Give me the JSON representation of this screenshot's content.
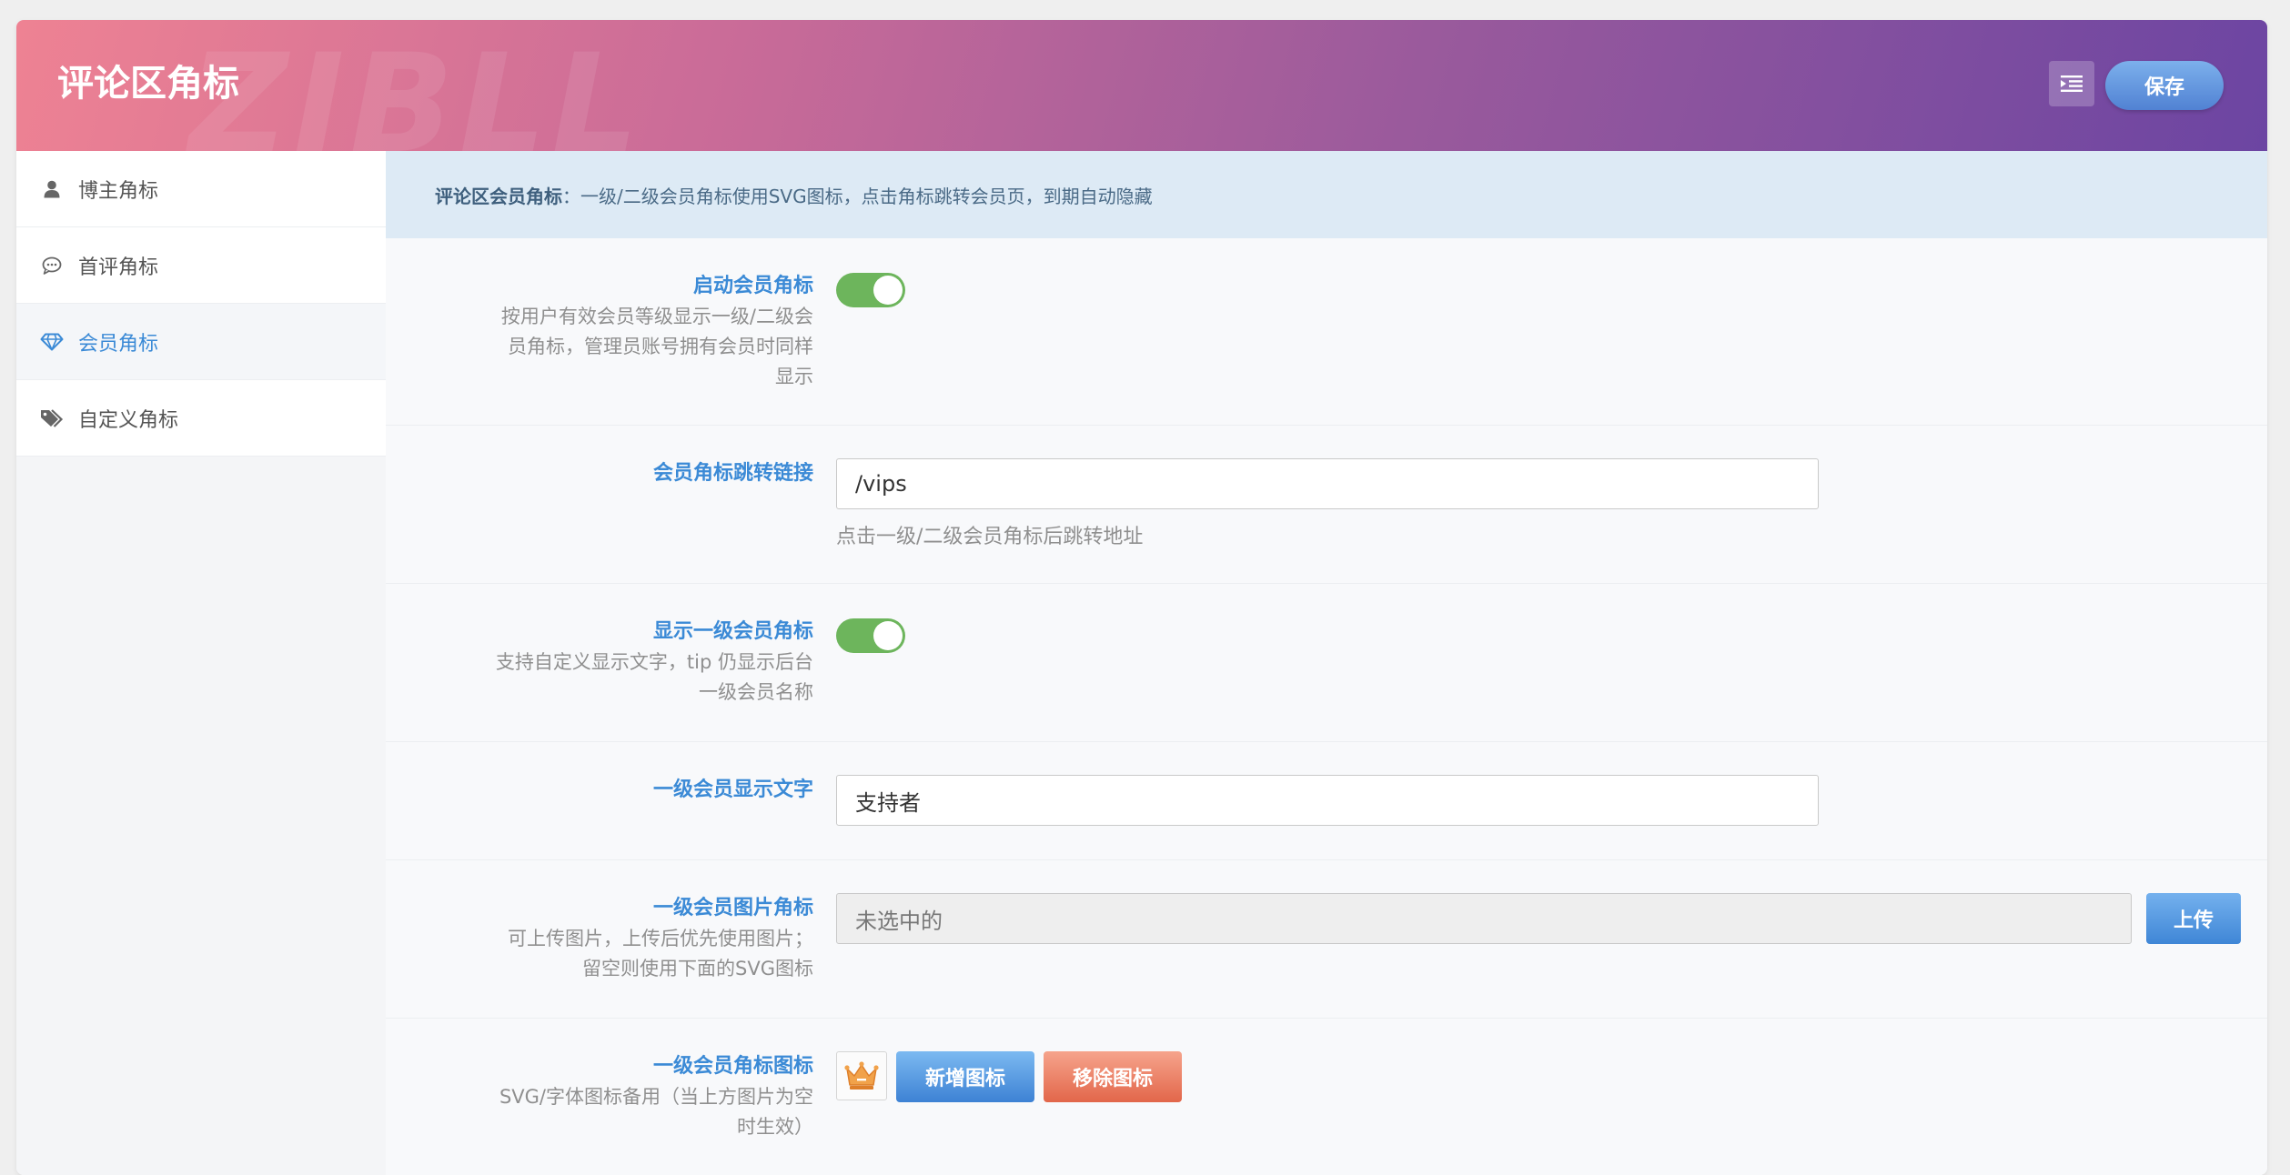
{
  "header": {
    "title": "评论区角标",
    "watermark": "ZIBLL",
    "save_label": "保存"
  },
  "sidebar": {
    "items": [
      {
        "label": "博主角标",
        "icon": "user-icon"
      },
      {
        "label": "首评角标",
        "icon": "comment-icon"
      },
      {
        "label": "会员角标",
        "icon": "diamond-icon",
        "active": true
      },
      {
        "label": "自定义角标",
        "icon": "tags-icon"
      }
    ]
  },
  "notice": {
    "title": "评论区会员角标",
    "sep": "：",
    "text": "一级/二级会员角标使用SVG图标，点击角标跳转会员页，到期自动隐藏"
  },
  "fields": {
    "enable": {
      "label": "启动会员角标",
      "desc_lines": [
        "按用户有效会员等级显示一级/二级会",
        "员角标，管理员账号拥有会员时同样",
        "显示"
      ],
      "on": true
    },
    "link": {
      "label": "会员角标跳转链接",
      "value": "/vips",
      "help": "点击一级/二级会员角标后跳转地址"
    },
    "show_level1": {
      "label": "显示一级会员角标",
      "desc_lines": [
        "支持自定义显示文字，tip 仍显示后台",
        "一级会员名称"
      ],
      "on": true
    },
    "level1_text": {
      "label": "一级会员显示文字",
      "value": "支持者"
    },
    "level1_image": {
      "label": "一级会员图片角标",
      "desc_lines": [
        "可上传图片，上传后优先使用图片；",
        "留空则使用下面的SVG图标"
      ],
      "value": "未选中的",
      "upload_label": "上传"
    },
    "level1_icon": {
      "label": "一级会员角标图标",
      "desc_lines": [
        "SVG/字体图标备用（当上方图片为空",
        "时生效）"
      ],
      "preview_icon": "crown-icon",
      "add_label": "新增图标",
      "remove_label": "移除图标"
    }
  },
  "colors": {
    "accent": "#3b8ad6",
    "toggle_on": "#6db55c",
    "notice_bg": "#ddeaf5"
  }
}
